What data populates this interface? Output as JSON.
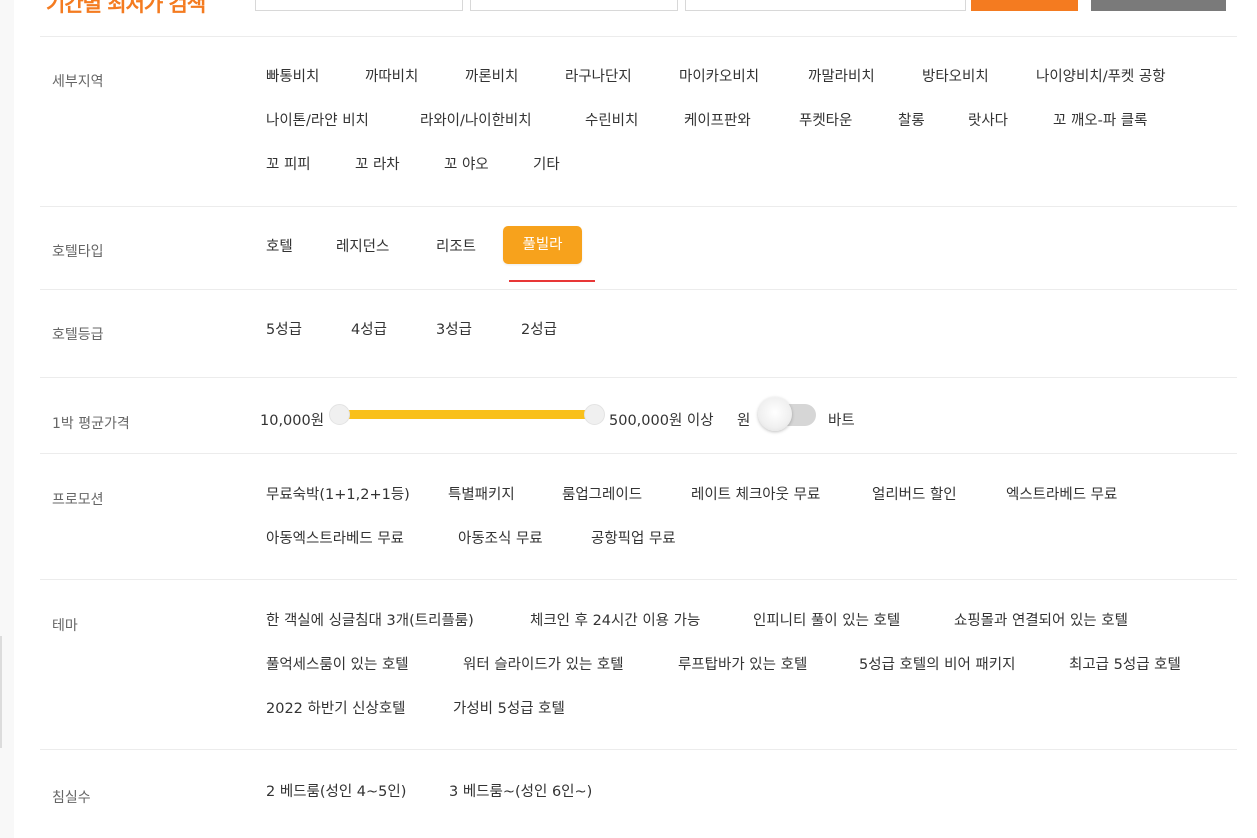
{
  "header": {
    "title": "기간별 최저가 검색"
  },
  "colors": {
    "accent": "#f47b20",
    "active_chip": "#f7a21c",
    "slider": "#f9c01b",
    "underline": "#e83737",
    "dark_button": "#7a7a7a"
  },
  "region": {
    "label": "세부지역",
    "options": [
      "빠통비치",
      "까따비치",
      "까론비치",
      "라구나단지",
      "마이카오비치",
      "까말라비치",
      "방타오비치",
      "나이양비치/푸켓 공항",
      "나이톤/라얀 비치",
      "라와이/나이한비치",
      "수린비치",
      "케이프판와",
      "푸켓타운",
      "찰롱",
      "랏사다",
      "꼬 깨오-파 클록",
      "꼬 피피",
      "꼬 라차",
      "꼬 야오",
      "기타"
    ]
  },
  "hotel_type": {
    "label": "호텔타입",
    "options": [
      "호텔",
      "레지던스",
      "리조트",
      "풀빌라"
    ],
    "selected": "풀빌라"
  },
  "hotel_grade": {
    "label": "호텔등급",
    "options": [
      "5성급",
      "4성급",
      "3성급",
      "2성급"
    ]
  },
  "price": {
    "label": "1박 평균가격",
    "min": "10,000원",
    "max": "500,000원 이상",
    "currency_left": "원",
    "currency_right": "바트",
    "range_fraction": [
      0,
      1
    ],
    "currency_toggle_on_baht": false
  },
  "promotion": {
    "label": "프로모션",
    "options": [
      "무료숙박(1+1,2+1등)",
      "특별패키지",
      "룸업그레이드",
      "레이트 체크아웃 무료",
      "얼리버드 할인",
      "엑스트라베드 무료",
      "아동엑스트라베드 무료",
      "아동조식 무료",
      "공항픽업 무료"
    ]
  },
  "theme": {
    "label": "테마",
    "options": [
      "한 객실에 싱글침대 3개(트리플룸)",
      "체크인 후 24시간 이용 가능",
      "인피니티 풀이 있는 호텔",
      "쇼핑몰과 연결되어 있는 호텔",
      "풀억세스룸이 있는 호텔",
      "워터 슬라이드가 있는 호텔",
      "루프탑바가 있는 호텔",
      "5성급 호텔의 비어 패키지",
      "최고급 5성급 호텔",
      "2022 하반기 신상호텔",
      "가성비 5성급 호텔"
    ]
  },
  "bedrooms": {
    "label": "침실수",
    "options": [
      "2 베드룸(성인 4~5인)",
      "3 베드룸~(성인 6인~)"
    ]
  }
}
